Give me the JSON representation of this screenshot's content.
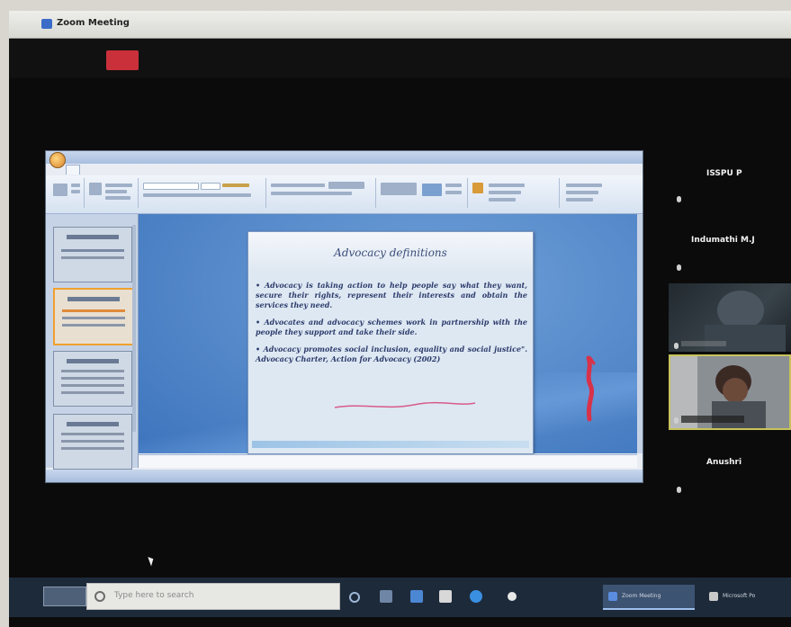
{
  "window": {
    "title": "Zoom Meeting"
  },
  "presentation": {
    "slide_title": "Advocacy definitions",
    "bullets": [
      "Advocacy is taking action to help people say what they want, secure their rights, represent their interests and obtain the services they need.",
      "Advocates and advocacy schemes work in partnership with the people they support and take their side.",
      "Advocacy promotes social inclusion, equality and social justice\". Advocacy Charter, Action for Advocacy (2002)"
    ]
  },
  "participants": [
    {
      "name": "ISSPU P"
    },
    {
      "name": "Indumathi M.J"
    },
    {
      "name": "Anushri"
    }
  ],
  "taskbar": {
    "search_placeholder": "Type here to search",
    "buttons": [
      {
        "label": "Zoom Meeting",
        "active": true
      },
      {
        "label": "Microsoft Po",
        "active": false
      }
    ]
  },
  "colors": {
    "recording_badge": "#c9303a",
    "active_speaker_border": "#c8c35a",
    "taskbar_bg": "#1d2a3a",
    "slide_title": "#3c4f7a",
    "annotation_red": "#d8324a"
  }
}
